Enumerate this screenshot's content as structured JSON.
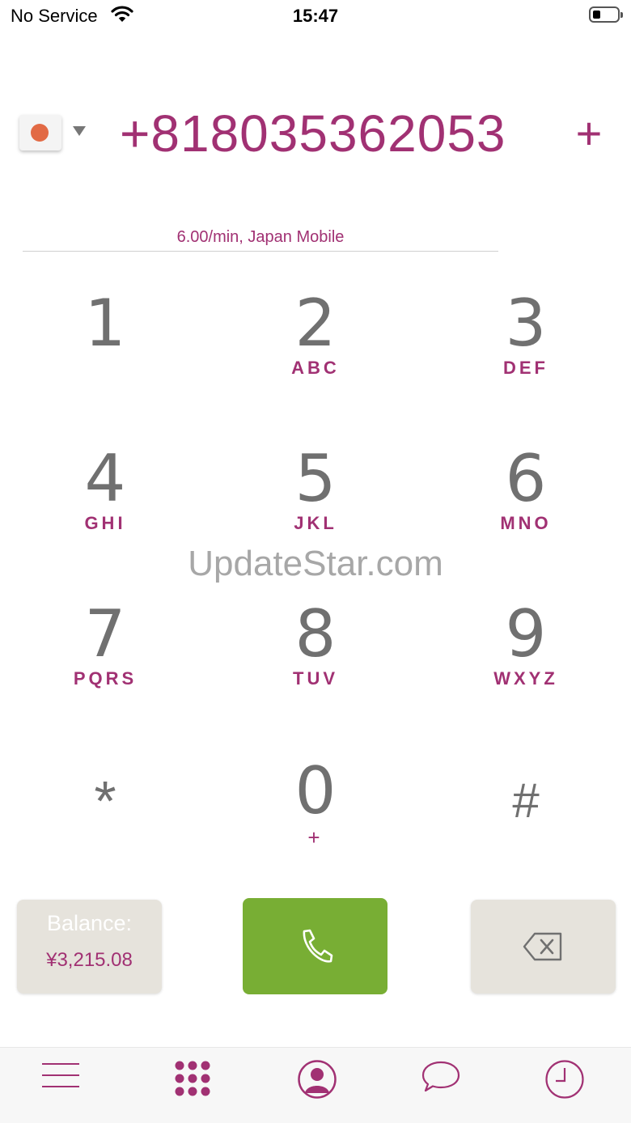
{
  "status_bar": {
    "carrier": "No Service",
    "time": "15:47",
    "battery_level": 0.3
  },
  "dialer": {
    "country_flag_icon": "japan-flag-icon",
    "phone_number": "+818035362053",
    "add_label": "+",
    "rate_info": "6.00/min, Japan Mobile"
  },
  "keypad": {
    "keys": [
      {
        "digit": "1",
        "letters": ""
      },
      {
        "digit": "2",
        "letters": "ABC"
      },
      {
        "digit": "3",
        "letters": "DEF"
      },
      {
        "digit": "4",
        "letters": "GHI"
      },
      {
        "digit": "5",
        "letters": "JKL"
      },
      {
        "digit": "6",
        "letters": "MNO"
      },
      {
        "digit": "7",
        "letters": "PQRS"
      },
      {
        "digit": "8",
        "letters": "TUV"
      },
      {
        "digit": "9",
        "letters": "WXYZ"
      },
      {
        "digit": "*",
        "letters": ""
      },
      {
        "digit": "0",
        "letters": "+"
      },
      {
        "digit": "#",
        "letters": ""
      }
    ]
  },
  "watermark": "UpdateStar.com",
  "actions": {
    "balance_label": "Balance:",
    "balance_amount": "¥3,215.08",
    "call_icon": "phone-icon",
    "delete_icon": "backspace-icon"
  },
  "tab_bar": {
    "items": [
      "menu-icon",
      "keypad-icon",
      "contacts-icon",
      "messages-icon",
      "history-icon"
    ],
    "active": "keypad-icon"
  },
  "colors": {
    "accent": "#a13173",
    "call_green": "#78ae34",
    "key_gray": "#707070",
    "button_bg": "#e6e3dc"
  }
}
